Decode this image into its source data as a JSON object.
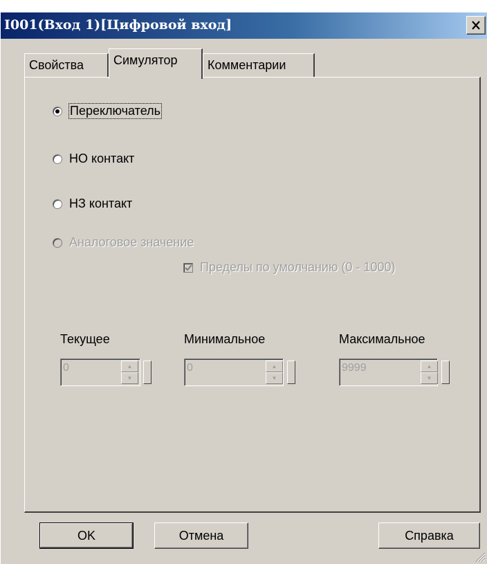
{
  "window": {
    "title": "I001(Вход 1)[Цифровой вход]"
  },
  "tabs": [
    {
      "label": "Свойства"
    },
    {
      "label": "Симулятор",
      "active": true
    },
    {
      "label": "Комментарии"
    }
  ],
  "simulator": {
    "mode_options": [
      {
        "label": "Переключатель",
        "checked": true,
        "enabled": true
      },
      {
        "label": "НО контакт",
        "checked": false,
        "enabled": true
      },
      {
        "label": "НЗ контакт",
        "checked": false,
        "enabled": true
      },
      {
        "label": "Аналоговое значение",
        "checked": false,
        "enabled": false
      }
    ],
    "default_limits": {
      "label": "Пределы по умолчанию (0 - 1000)",
      "checked": true,
      "enabled": false
    },
    "fields": [
      {
        "label": "Текущее",
        "value": "0"
      },
      {
        "label": "Минимальное",
        "value": "0"
      },
      {
        "label": "Максимальное",
        "value": "9999"
      }
    ]
  },
  "buttons": {
    "ok": "OK",
    "cancel": "Отмена",
    "help": "Справка"
  },
  "colors": {
    "face": "#d4d0c8",
    "title_start": "#0a246a",
    "title_end": "#a6caf0",
    "disabled_text": "#a0a0a0"
  }
}
